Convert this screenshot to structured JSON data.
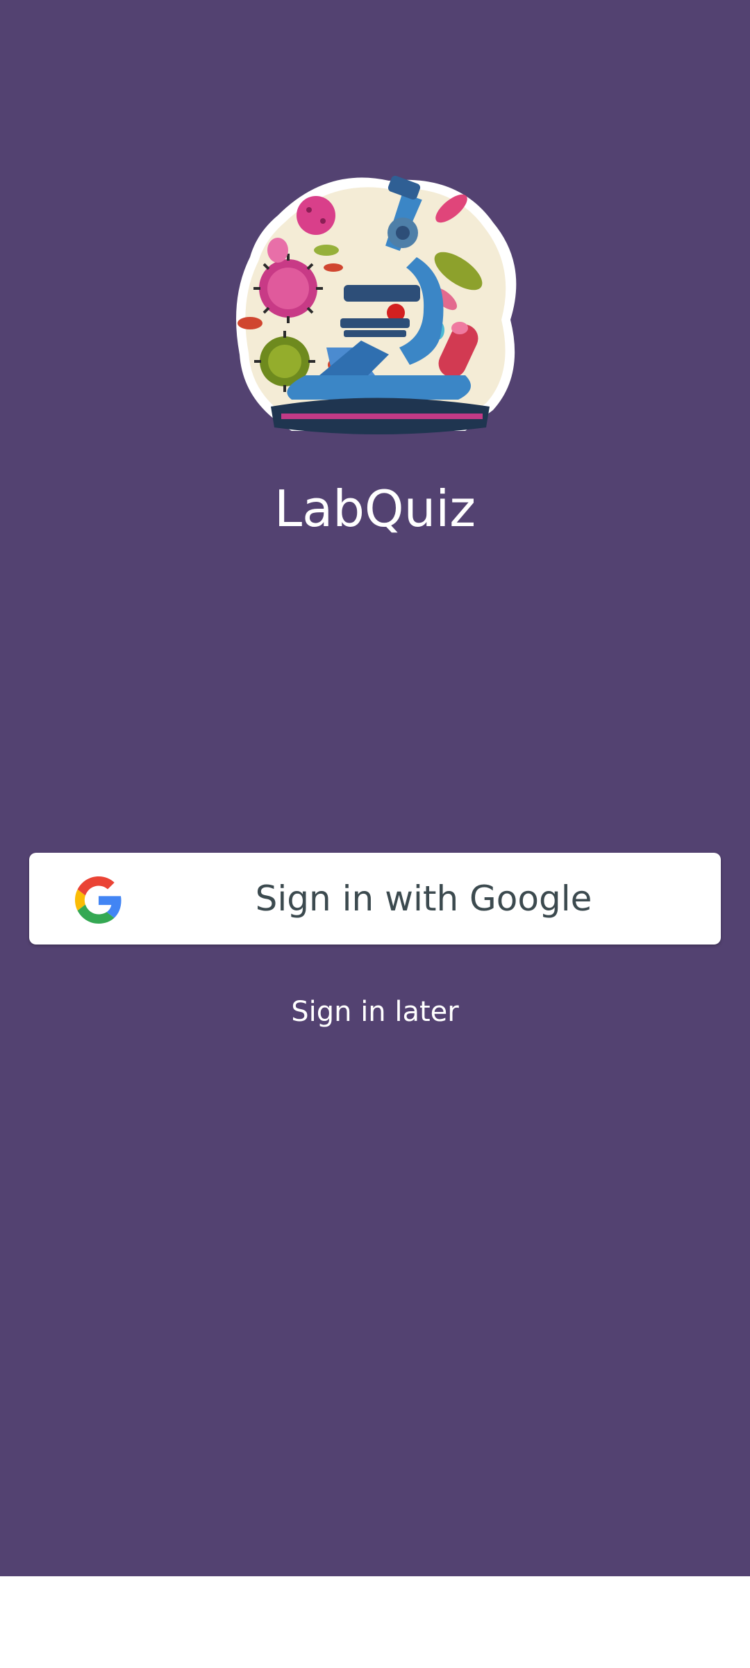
{
  "app": {
    "title": "LabQuiz",
    "logo_icon": "microscope-microbes-logo"
  },
  "auth": {
    "google_button_label": "Sign in with Google",
    "google_icon": "google-g-icon",
    "later_label": "Sign in later"
  },
  "colors": {
    "background": "#534271",
    "button_bg": "#ffffff",
    "button_text": "#3c4a4f",
    "title_text": "#ffffff"
  }
}
